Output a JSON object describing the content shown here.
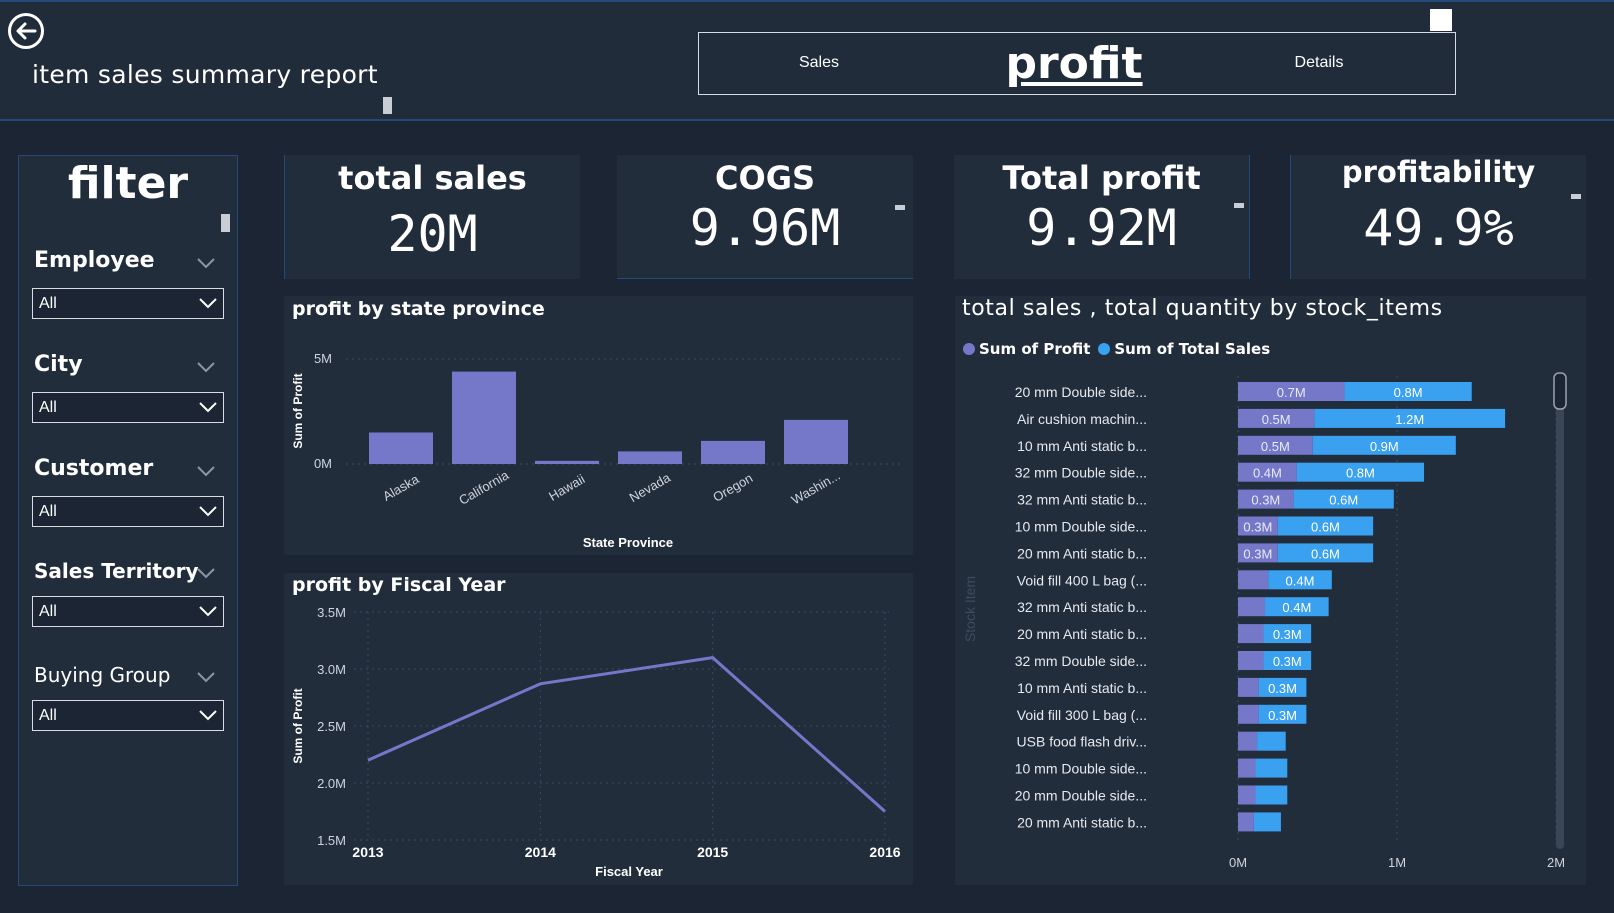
{
  "header": {
    "title": "item sales summary report",
    "tabs": [
      {
        "label": "Sales"
      },
      {
        "label": "profit"
      },
      {
        "label": "Details"
      }
    ]
  },
  "filter": {
    "title": "filter",
    "slicers": [
      {
        "label": "Employee",
        "value": "All"
      },
      {
        "label": "City",
        "value": "All"
      },
      {
        "label": "Customer",
        "value": "All"
      },
      {
        "label": "Sales Territory",
        "value": "All"
      },
      {
        "label": "Buying Group",
        "value": "All"
      }
    ]
  },
  "kpis": [
    {
      "title": "total sales",
      "value": "20M"
    },
    {
      "title": "COGS",
      "value": "9.96M"
    },
    {
      "title": "Total profit",
      "value": "9.92M"
    },
    {
      "title": "profitability",
      "value": "49.9%"
    }
  ],
  "colors": {
    "background": "#1b2533",
    "panel": "#222d3c",
    "profit": "#7577c9",
    "total_sales": "#3aa0f0",
    "border": "#244a7a"
  },
  "chart_data": [
    {
      "type": "bar",
      "title": "profit by state province",
      "xlabel": "State Province",
      "ylabel": "Sum of Profit",
      "categories": [
        "Alaska",
        "California",
        "Hawaii",
        "Nevada",
        "Oregon",
        "Washin..."
      ],
      "values": [
        1.5,
        4.4,
        0.15,
        0.6,
        1.1,
        2.1
      ],
      "value_unit": "M",
      "ylim": [
        0,
        5
      ],
      "yticks": [
        "0M",
        "5M"
      ],
      "grid": true
    },
    {
      "type": "line",
      "title": "profit by Fiscal Year",
      "xlabel": "Fiscal Year",
      "ylabel": "Sum of Profit",
      "x": [
        "2013",
        "2014",
        "2015",
        "2016"
      ],
      "values": [
        2.2,
        2.87,
        3.1,
        1.75
      ],
      "value_unit": "M",
      "ylim": [
        1.5,
        3.5
      ],
      "yticks": [
        "1.5M",
        "2.0M",
        "2.5M",
        "3.0M",
        "3.5M"
      ],
      "grid": true
    },
    {
      "type": "bar",
      "orientation": "horizontal",
      "stacked": true,
      "title": "total sales , total quantity by stock_items",
      "ylabel": "Stock Item",
      "xlim": [
        0,
        2
      ],
      "xticks": [
        "0M",
        "1M",
        "2M"
      ],
      "legend_position": "top-left",
      "categories": [
        "20 mm Double side...",
        "Air cushion machin...",
        "10 mm Anti static b...",
        "32 mm Double side...",
        "32 mm Anti static b...",
        "10 mm Double side...",
        "20 mm Anti static b...",
        "Void fill 400 L bag (...",
        "32 mm Anti static b...",
        "20 mm Anti static b...",
        "32 mm Double side...",
        "10 mm Anti static b...",
        "Void fill 300 L bag (...",
        "USB food flash driv...",
        "10 mm Double side...",
        "20 mm Double side...",
        "20 mm Anti static b..."
      ],
      "series": [
        {
          "name": "Sum of Profit",
          "values": [
            0.67,
            0.48,
            0.47,
            0.37,
            0.35,
            0.25,
            0.25,
            0.19,
            0.17,
            0.16,
            0.16,
            0.13,
            0.13,
            0.12,
            0.11,
            0.11,
            0.1
          ],
          "labels": [
            "0.7M",
            "0.5M",
            "0.5M",
            "0.4M",
            "0.3M",
            "0.3M",
            "0.3M",
            "",
            "",
            "",
            "",
            "",
            "",
            "",
            "",
            "",
            ""
          ]
        },
        {
          "name": "Sum of Total Sales",
          "values": [
            0.8,
            1.2,
            0.9,
            0.8,
            0.63,
            0.6,
            0.6,
            0.4,
            0.4,
            0.3,
            0.3,
            0.3,
            0.3,
            0.18,
            0.2,
            0.2,
            0.17
          ],
          "labels": [
            "0.8M",
            "1.2M",
            "0.9M",
            "0.8M",
            "0.6M",
            "0.6M",
            "0.6M",
            "0.4M",
            "0.4M",
            "0.3M",
            "0.3M",
            "0.3M",
            "0.3M",
            "",
            "",
            "",
            ""
          ]
        }
      ]
    }
  ]
}
